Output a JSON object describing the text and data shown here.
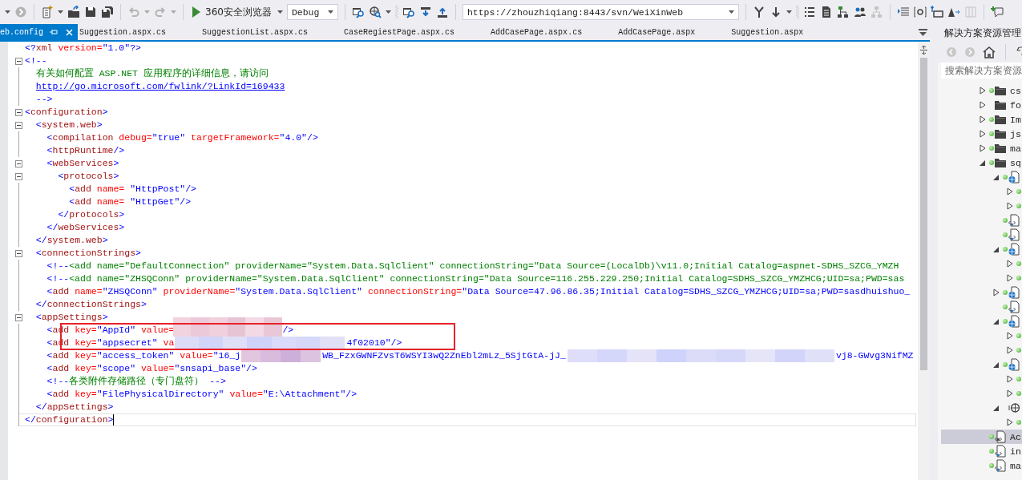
{
  "toolbar": {
    "undo": {
      "disabled": true
    },
    "redo": {
      "disabled": true
    },
    "run_target": "360安全浏览器",
    "configuration": "Debug",
    "url": "https://zhouzhiqiang:8443/svn/WeiXinWeb"
  },
  "tabs": [
    {
      "label": "eb.config",
      "selected": true
    },
    {
      "label": "Suggestion.aspx.cs",
      "selected": false
    },
    {
      "label": "SuggestionList.aspx.cs",
      "selected": false
    },
    {
      "label": "CaseRegiestPage.aspx.cs",
      "selected": false
    },
    {
      "label": "AddCasePage.aspx.cs",
      "selected": false
    },
    {
      "label": "AddCasePage.aspx",
      "selected": false
    },
    {
      "label": "Suggestion.aspx",
      "selected": false
    }
  ],
  "lines": [
    {
      "fold": false,
      "current": false,
      "tokens": [
        {
          "kind": "bracket",
          "text": "<?"
        },
        {
          "kind": "tag",
          "text": "xml"
        },
        {
          "kind": "attr",
          "text": " version="
        },
        {
          "kind": "value",
          "text": "\"1.0\""
        },
        {
          "kind": "bracket",
          "text": "?>"
        }
      ]
    },
    {
      "fold": true,
      "current": false,
      "tokens": [
        {
          "kind": "bracket",
          "text": "<!--"
        }
      ]
    },
    {
      "fold": false,
      "current": false,
      "tokens": [
        {
          "kind": "comment",
          "text": "  有关如何配置 ASP.NET 应用程序的详细信息，请访问"
        }
      ]
    },
    {
      "fold": false,
      "current": false,
      "tokens": [
        {
          "kind": "link",
          "text": "  http://go.microsoft.com/fwlink/?LinkId=169433"
        }
      ]
    },
    {
      "fold": false,
      "current": false,
      "tokens": [
        {
          "kind": "bracket",
          "text": "  -->"
        }
      ]
    },
    {
      "fold": true,
      "current": false,
      "tokens": [
        {
          "kind": "bracket",
          "text": "<"
        },
        {
          "kind": "tag",
          "text": "configuration"
        },
        {
          "kind": "bracket",
          "text": ">"
        }
      ]
    },
    {
      "fold": true,
      "current": false,
      "tokens": [
        {
          "kind": "bracket",
          "text": "  <"
        },
        {
          "kind": "tag",
          "text": "system.web"
        },
        {
          "kind": "bracket",
          "text": ">"
        }
      ]
    },
    {
      "fold": false,
      "current": false,
      "tokens": [
        {
          "kind": "bracket",
          "text": "    <"
        },
        {
          "kind": "tag",
          "text": "compilation"
        },
        {
          "kind": "attr",
          "text": " debug="
        },
        {
          "kind": "value",
          "text": "\"true\""
        },
        {
          "kind": "attr",
          "text": " targetFramework="
        },
        {
          "kind": "value",
          "text": "\"4.0\""
        },
        {
          "kind": "bracket",
          "text": "/>"
        }
      ]
    },
    {
      "fold": false,
      "current": false,
      "tokens": [
        {
          "kind": "bracket",
          "text": "    <"
        },
        {
          "kind": "tag",
          "text": "httpRuntime"
        },
        {
          "kind": "bracket",
          "text": "/>"
        }
      ]
    },
    {
      "fold": true,
      "current": false,
      "tokens": [
        {
          "kind": "bracket",
          "text": "    <"
        },
        {
          "kind": "tag",
          "text": "webServices"
        },
        {
          "kind": "bracket",
          "text": ">"
        }
      ]
    },
    {
      "fold": true,
      "current": false,
      "tokens": [
        {
          "kind": "bracket",
          "text": "      <"
        },
        {
          "kind": "tag",
          "text": "protocols"
        },
        {
          "kind": "bracket",
          "text": ">"
        }
      ]
    },
    {
      "fold": false,
      "current": false,
      "tokens": [
        {
          "kind": "bracket",
          "text": "        <"
        },
        {
          "kind": "tag",
          "text": "add"
        },
        {
          "kind": "attr",
          "text": " name="
        },
        {
          "kind": "value",
          "text": " \"HttpPost\""
        },
        {
          "kind": "bracket",
          "text": "/>"
        }
      ]
    },
    {
      "fold": false,
      "current": false,
      "tokens": [
        {
          "kind": "bracket",
          "text": "        <"
        },
        {
          "kind": "tag",
          "text": "add"
        },
        {
          "kind": "attr",
          "text": " name="
        },
        {
          "kind": "value",
          "text": " \"HttpGet\""
        },
        {
          "kind": "bracket",
          "text": "/>"
        }
      ]
    },
    {
      "fold": false,
      "current": false,
      "tokens": [
        {
          "kind": "bracket",
          "text": "      </"
        },
        {
          "kind": "tag",
          "text": "protocols"
        },
        {
          "kind": "bracket",
          "text": ">"
        }
      ]
    },
    {
      "fold": false,
      "current": false,
      "tokens": [
        {
          "kind": "bracket",
          "text": "    </"
        },
        {
          "kind": "tag",
          "text": "webServices"
        },
        {
          "kind": "bracket",
          "text": ">"
        }
      ]
    },
    {
      "fold": false,
      "current": false,
      "tokens": [
        {
          "kind": "bracket",
          "text": "  </"
        },
        {
          "kind": "tag",
          "text": "system.web"
        },
        {
          "kind": "bracket",
          "text": ">"
        }
      ]
    },
    {
      "fold": true,
      "current": false,
      "tokens": [
        {
          "kind": "bracket",
          "text": "  <"
        },
        {
          "kind": "tag",
          "text": "connectionStrings"
        },
        {
          "kind": "bracket",
          "text": ">"
        }
      ]
    },
    {
      "fold": false,
      "current": false,
      "tokens": [
        {
          "kind": "bracket",
          "text": "    <!--"
        },
        {
          "kind": "comment",
          "text": "<add name=\"DefaultConnection\" providerName=\"System.Data.SqlClient\" connectionString=\"Data Source=(LocalDb)\\v11.0;Initial Catalog=aspnet-SDHS_SZCG_YMZH"
        }
      ]
    },
    {
      "fold": false,
      "current": false,
      "tokens": [
        {
          "kind": "bracket",
          "text": "    <!--"
        },
        {
          "kind": "comment",
          "text": "<add name=\"ZHSQConn\" providerName=\"System.Data.SqlClient\" connectionString=\"Data Source=116.255.229.250;Initial Catalog=SDHS_SZCG_YMZHCG;UID=sa;PWD=sas"
        }
      ]
    },
    {
      "fold": false,
      "current": false,
      "tokens": [
        {
          "kind": "bracket",
          "text": "    <"
        },
        {
          "kind": "tag",
          "text": "add"
        },
        {
          "kind": "attr",
          "text": " name="
        },
        {
          "kind": "value",
          "text": "\"ZHSQConn\""
        },
        {
          "kind": "attr",
          "text": " providerName="
        },
        {
          "kind": "value",
          "text": "\"System.Data.SqlClient\""
        },
        {
          "kind": "attr",
          "text": " connectionString="
        },
        {
          "kind": "value",
          "text": "\"Data Source=47.96.86.35;Initial Catalog=SDHS_SZCG_YMZHCG;UID=sa;PWD=sasdhuishuo_"
        }
      ]
    },
    {
      "fold": false,
      "current": false,
      "tokens": [
        {
          "kind": "bracket",
          "text": "  </"
        },
        {
          "kind": "tag",
          "text": "connectionStrings"
        },
        {
          "kind": "bracket",
          "text": ">"
        }
      ]
    },
    {
      "fold": true,
      "current": false,
      "tokens": [
        {
          "kind": "bracket",
          "text": "  <"
        },
        {
          "kind": "tag",
          "text": "appSettings"
        },
        {
          "kind": "bracket",
          "text": ">"
        }
      ]
    },
    {
      "fold": false,
      "current": false,
      "tokens": [
        {
          "kind": "bracket",
          "text": "    <"
        },
        {
          "kind": "tag",
          "text": "add"
        },
        {
          "kind": "attr",
          "text": " key="
        },
        {
          "kind": "value",
          "text": "\"AppId\""
        },
        {
          "kind": "attr",
          "text": " value="
        },
        {
          "kind": "redacted"
        },
        {
          "kind": "bracket",
          "text": "/>"
        }
      ]
    },
    {
      "fold": false,
      "current": false,
      "tokens": [
        {
          "kind": "bracket",
          "text": "    <"
        },
        {
          "kind": "tag",
          "text": "add"
        },
        {
          "kind": "attr",
          "text": " key="
        },
        {
          "kind": "value",
          "text": "\"appsecret\""
        },
        {
          "kind": "attr",
          "text": " va"
        },
        {
          "kind": "redacted"
        },
        {
          "kind": "value",
          "text": "4f02010\""
        },
        {
          "kind": "bracket",
          "text": "/>"
        }
      ]
    },
    {
      "fold": false,
      "current": false,
      "tokens": [
        {
          "kind": "bracket",
          "text": "    <"
        },
        {
          "kind": "tag",
          "text": "add"
        },
        {
          "kind": "attr",
          "text": " key="
        },
        {
          "kind": "value",
          "text": "\"access_token\""
        },
        {
          "kind": "attr",
          "text": " value="
        },
        {
          "kind": "value",
          "text": "\"16_j"
        },
        {
          "kind": "redacted"
        },
        {
          "kind": "value",
          "text": "WB_FzxGWNFZvsT6WSYI3wQ2ZnEbl2mLz_5SjtGtA-jJ_"
        },
        {
          "kind": "redacted"
        },
        {
          "kind": "value",
          "text": "vj8-GWvg3NifMZ"
        }
      ]
    },
    {
      "fold": false,
      "current": false,
      "tokens": [
        {
          "kind": "bracket",
          "text": "    <"
        },
        {
          "kind": "tag",
          "text": "add"
        },
        {
          "kind": "attr",
          "text": " key="
        },
        {
          "kind": "value",
          "text": "\"scope\""
        },
        {
          "kind": "attr",
          "text": " value="
        },
        {
          "kind": "value",
          "text": "\"snsapi_base\""
        },
        {
          "kind": "bracket",
          "text": "/>"
        }
      ]
    },
    {
      "fold": false,
      "current": false,
      "tokens": [
        {
          "kind": "bracket",
          "text": "    <!--"
        },
        {
          "kind": "comment",
          "text": "各类附件存储路径（专门盘符） "
        },
        {
          "kind": "bracket",
          "text": "-->"
        }
      ]
    },
    {
      "fold": false,
      "current": false,
      "tokens": [
        {
          "kind": "bracket",
          "text": "    <"
        },
        {
          "kind": "tag",
          "text": "add"
        },
        {
          "kind": "attr",
          "text": " key="
        },
        {
          "kind": "value",
          "text": "\"FilePhysicalDirectory\""
        },
        {
          "kind": "attr",
          "text": " value="
        },
        {
          "kind": "value",
          "text": "\"E:\\Attachment\""
        },
        {
          "kind": "bracket",
          "text": "/>"
        }
      ]
    },
    {
      "fold": false,
      "current": false,
      "tokens": [
        {
          "kind": "bracket",
          "text": "  </"
        },
        {
          "kind": "tag",
          "text": "appSettings"
        },
        {
          "kind": "bracket",
          "text": ">"
        }
      ]
    },
    {
      "fold": false,
      "current": true,
      "tokens": [
        {
          "kind": "bracket",
          "text": "</"
        },
        {
          "kind": "tag",
          "text": "configuration"
        },
        {
          "kind": "bracket",
          "text": ">"
        }
      ]
    }
  ],
  "explorer": {
    "title": "解决方案资源管理",
    "search": {
      "placeholder": "搜索解决方案资源"
    },
    "tree": [
      {
        "label": "cs",
        "kind": "folder",
        "tracked": true,
        "expanded": false,
        "selected": false
      },
      {
        "label": "fo",
        "kind": "folder",
        "tracked": false,
        "expanded": false,
        "selected": false
      },
      {
        "label": "Im",
        "kind": "folder",
        "tracked": true,
        "expanded": false,
        "selected": false
      },
      {
        "label": "js",
        "kind": "folder",
        "tracked": true,
        "expanded": false,
        "selected": false
      },
      {
        "label": "ma",
        "kind": "folder",
        "tracked": true,
        "expanded": false,
        "selected": false
      },
      {
        "label": "sq",
        "kind": "folder",
        "tracked": true,
        "expanded": true,
        "selected": false,
        "children": [
          {
            "kind": "web",
            "tracked": true,
            "expanded": true,
            "selected": false,
            "children": [
              {
                "tracked": true,
                "expanded": false,
                "selected": false
              },
              {
                "tracked": true,
                "expanded": false,
                "selected": false
              }
            ]
          },
          {
            "kind": "page",
            "tracked": true,
            "selected": false
          },
          {
            "kind": "page",
            "tracked": true,
            "selected": false
          },
          {
            "kind": "web",
            "tracked": true,
            "expanded": true,
            "selected": false,
            "children": [
              {
                "tracked": true,
                "expanded": false,
                "selected": false
              },
              {
                "tracked": true,
                "expanded": false,
                "selected": false
              }
            ]
          },
          {
            "kind": "web",
            "tracked": true,
            "expanded": false,
            "selected": false
          },
          {
            "kind": "page",
            "tracked": true,
            "selected": false
          },
          {
            "kind": "web",
            "tracked": true,
            "expanded": true,
            "selected": false,
            "children": [
              {
                "tracked": true,
                "expanded": false,
                "selected": false
              },
              {
                "tracked": true,
                "expanded": false,
                "selected": false
              }
            ]
          },
          {
            "kind": "web",
            "tracked": true,
            "expanded": true,
            "selected": false,
            "children": [
              {
                "tracked": true,
                "expanded": false,
                "selected": false
              },
              {
                "tracked": true,
                "expanded": false,
                "selected": false
              }
            ]
          },
          {
            "kind": "service",
            "tracked": false,
            "expanded": true,
            "selected": false,
            "children": [
              {
                "tracked": true,
                "expanded": false,
                "selected": false
              }
            ]
          }
        ]
      },
      {
        "label": "Ac",
        "kind": "config",
        "tracked": true,
        "selected": true
      },
      {
        "label": "in",
        "kind": "page",
        "tracked": true,
        "selected": false
      },
      {
        "label": "ma",
        "kind": "page",
        "tracked": true,
        "selected": false
      }
    ]
  }
}
